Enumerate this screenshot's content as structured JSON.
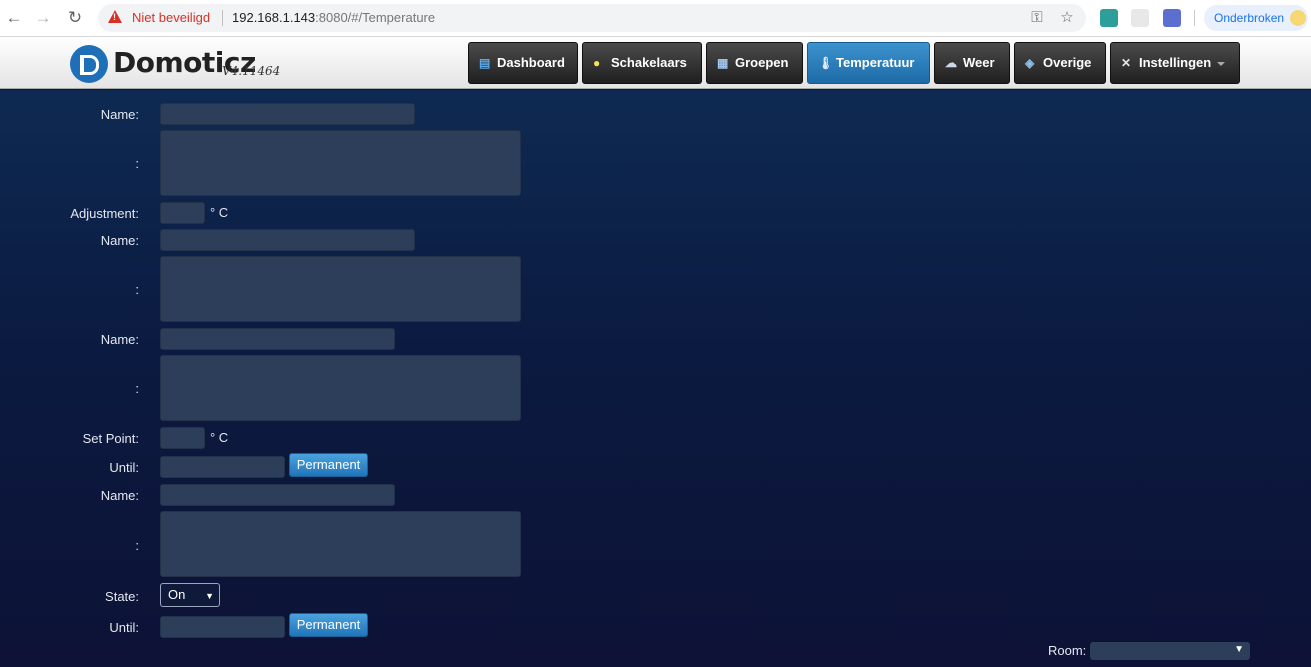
{
  "browser": {
    "not_secure": "Niet beveiligd",
    "url_host": "192.168.1.143",
    "url_rest": ":8080/#/Temperature",
    "profile": "Onderbroken"
  },
  "app": {
    "logo_name": "Domoticz",
    "logo_version": "V4.11464"
  },
  "menu": [
    {
      "label": "Dashboard",
      "icon": "dashboard-icon"
    },
    {
      "label": "Schakelaars",
      "icon": "lightbulb-icon"
    },
    {
      "label": "Groepen",
      "icon": "clapperboard-icon"
    },
    {
      "label": "Temperatuur",
      "icon": "thermometer-icon",
      "active": true
    },
    {
      "label": "Weer",
      "icon": "weather-icon"
    },
    {
      "label": "Overige",
      "icon": "other-icon"
    },
    {
      "label": "Instellingen",
      "icon": "tools-icon"
    }
  ],
  "form": {
    "name_label": "Name:",
    "desc_label": ":",
    "adjustment_label": "Adjustment:",
    "unit": "° C",
    "setpoint_label": "Set Point:",
    "until_label": "Until:",
    "permanent_label": "Permanent",
    "state_label": "State:",
    "state_value": "On",
    "room_label": "Room:"
  }
}
